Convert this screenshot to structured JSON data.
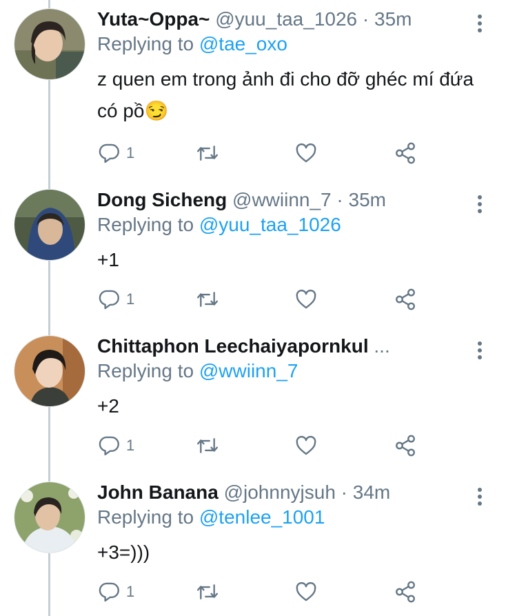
{
  "tweets": [
    {
      "name": "Yuta~Oppa~",
      "meta": "@yuu_taa_1026 · 35m",
      "replying_label": "Replying to ",
      "replying_to": "@tae_oxo",
      "text": "z quen em trong ảnh đi cho đỡ ghéc mí đứa có pồ😏",
      "reply_count": "1"
    },
    {
      "name": "Dong Sicheng",
      "meta": "@wwiinn_7 · 35m",
      "replying_label": "Replying to ",
      "replying_to": "@yuu_taa_1026",
      "text": "+1",
      "reply_count": "1"
    },
    {
      "name": "Chittaphon Leechaiyapornkul",
      "meta": "...",
      "replying_label": "Replying to ",
      "replying_to": "@wwiinn_7",
      "text": "+2",
      "reply_count": "1"
    },
    {
      "name": "John Banana",
      "meta": "@johnnyjsuh · 34m",
      "replying_label": "Replying to ",
      "replying_to": "@tenlee_1001",
      "text": "+3=)))",
      "reply_count": "1"
    }
  ],
  "icons": {
    "reply": "reply-icon",
    "retweet": "retweet-icon",
    "like": "heart-icon",
    "share": "share-icon",
    "more": "more-vertical-icon"
  },
  "colors": {
    "link": "#1da1f2",
    "secondary": "#657786",
    "thread_line": "#c4cfd6"
  }
}
